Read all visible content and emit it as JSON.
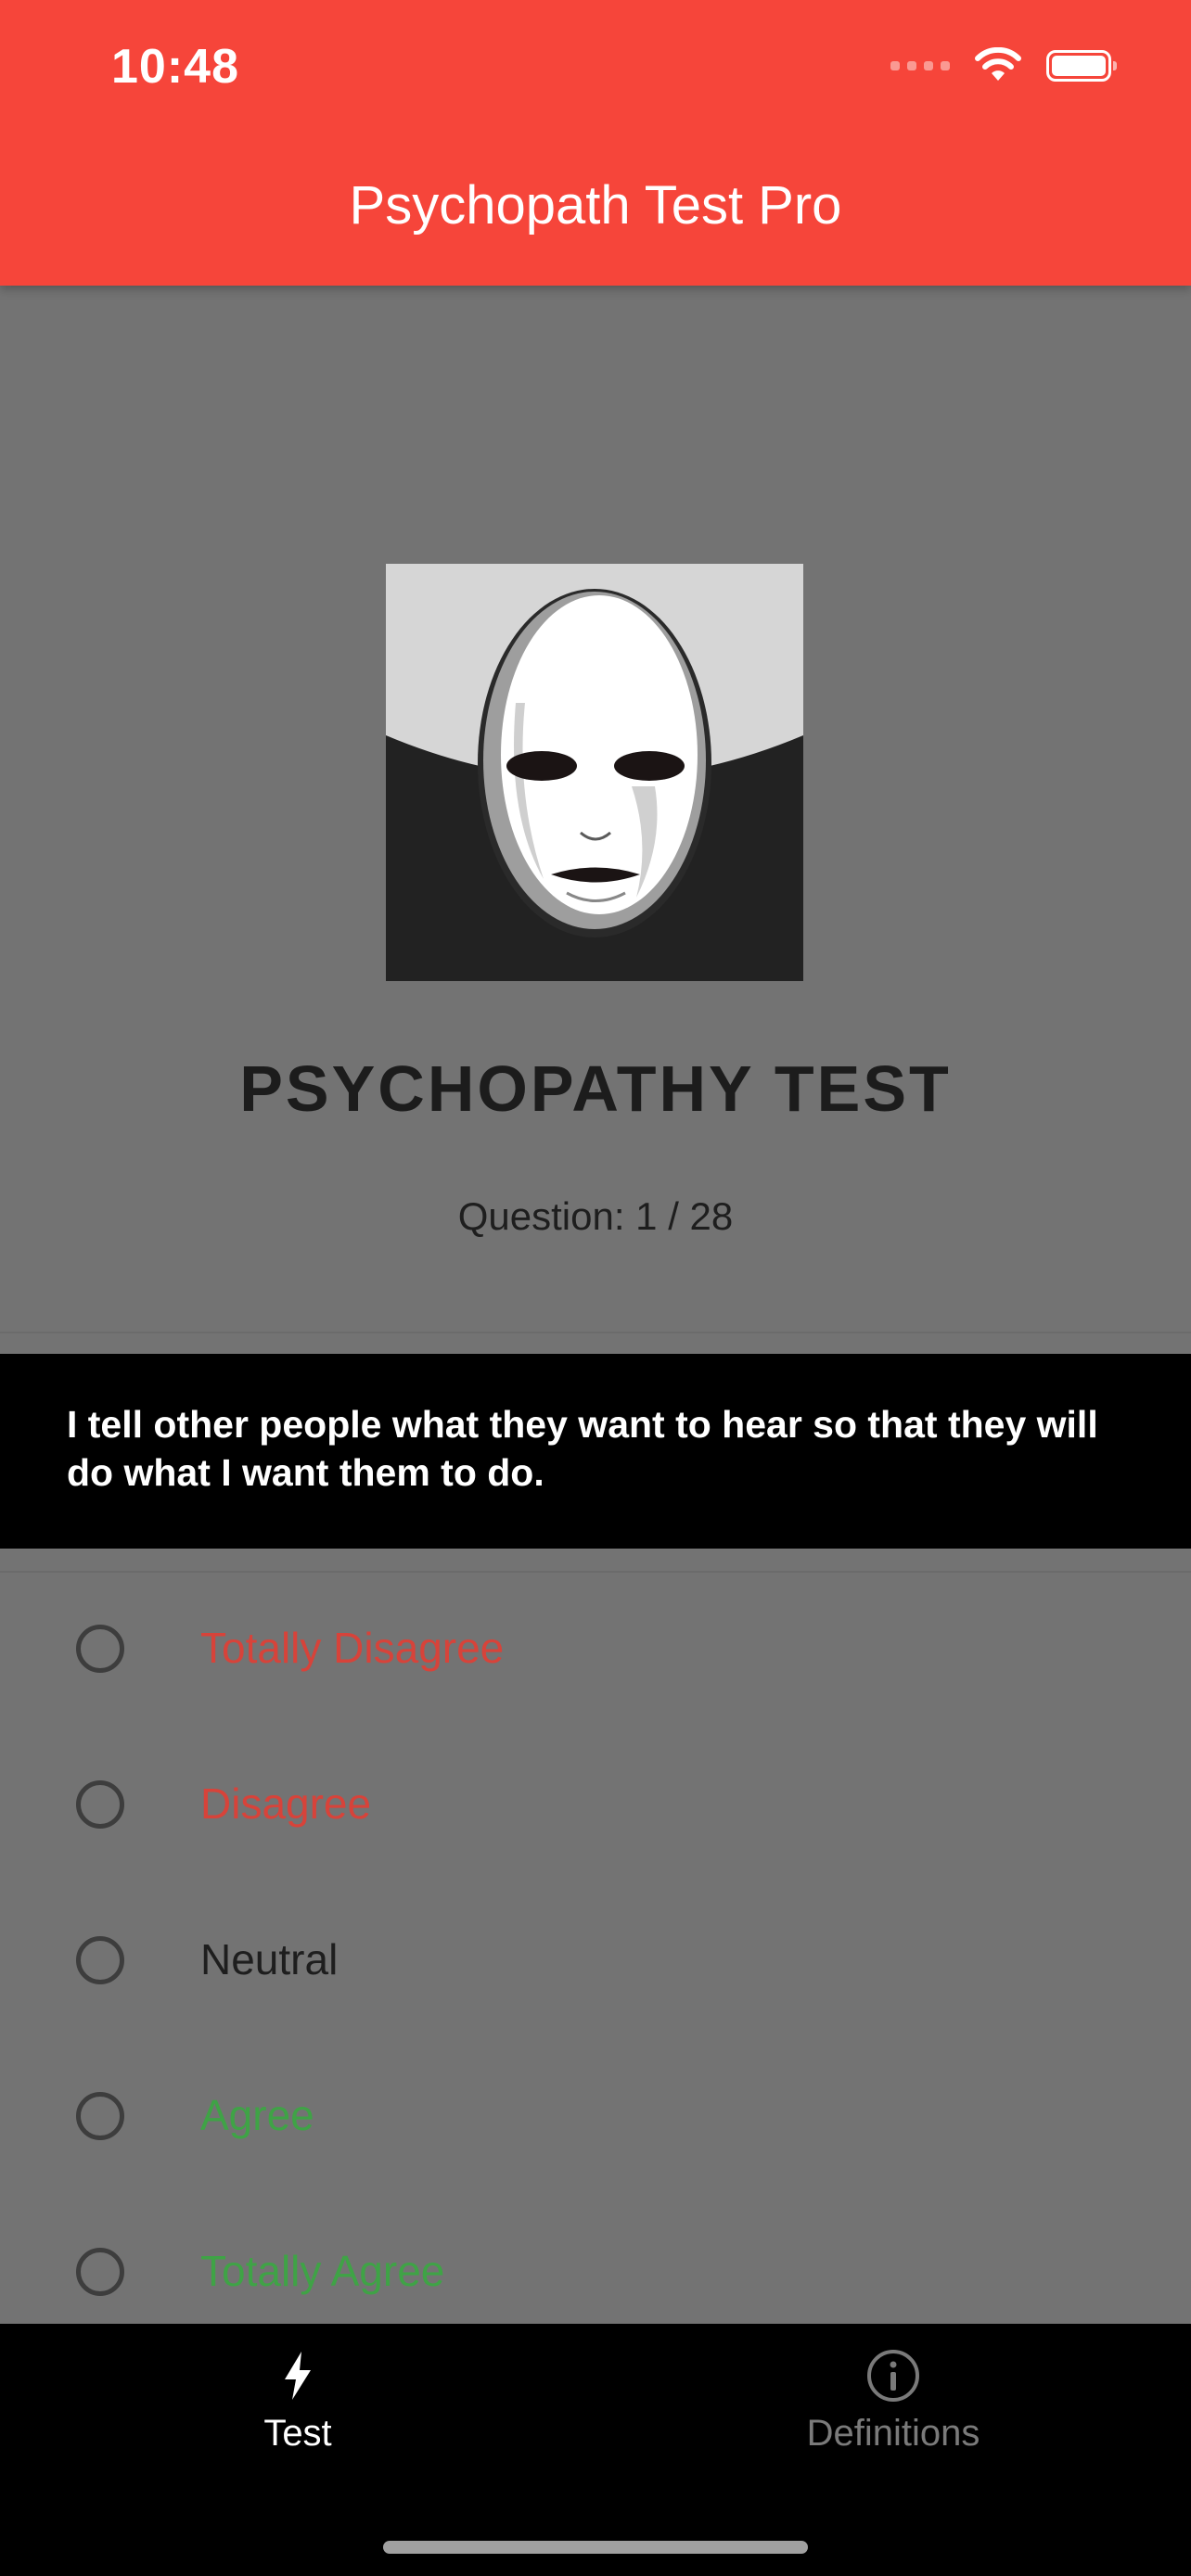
{
  "status_bar": {
    "time": "10:48"
  },
  "header": {
    "title": "Psychopath Test Pro"
  },
  "test": {
    "title": "PSYCHOPATHY TEST",
    "counter": "Question: 1 / 28",
    "question": "I tell other people what they want to hear so that they will do what I want them to do."
  },
  "options": [
    {
      "label": "Totally Disagree",
      "color": "#d7433a"
    },
    {
      "label": "Disagree",
      "color": "#d7433a"
    },
    {
      "label": "Neutral",
      "color": "#1e1e1e"
    },
    {
      "label": "Agree",
      "color": "#3fa346"
    },
    {
      "label": "Totally Agree",
      "color": "#3fa346"
    }
  ],
  "tabs": [
    {
      "label": "Test",
      "icon": "bolt-icon",
      "active": true
    },
    {
      "label": "Definitions",
      "icon": "info-icon",
      "active": false
    }
  ],
  "colors": {
    "accent": "#f6453a",
    "background": "#737373",
    "tab_inactive": "#7a7a7a"
  }
}
